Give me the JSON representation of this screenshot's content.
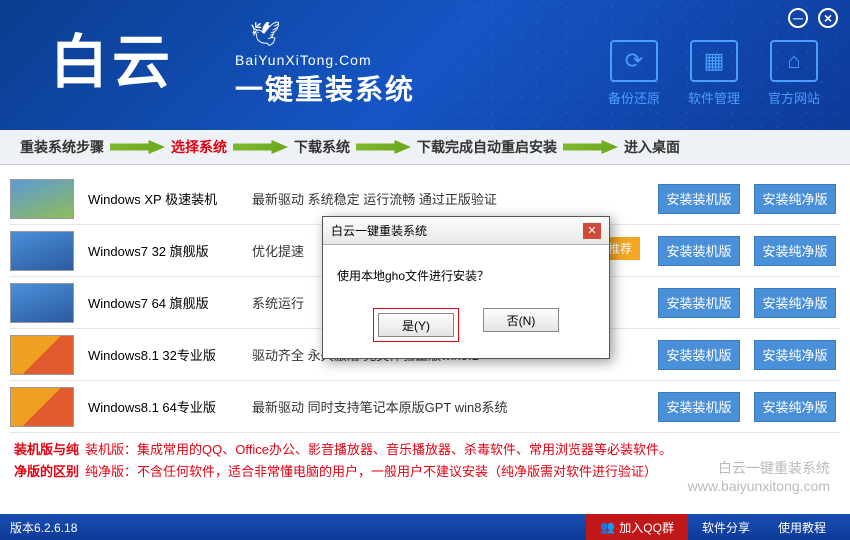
{
  "header": {
    "logo": "白云",
    "url": "BaiYunXiTong.Com",
    "slogan": "一键重装系统",
    "nav": [
      {
        "icon": "⟳",
        "label": "备份还原"
      },
      {
        "icon": "▦",
        "label": "软件管理"
      },
      {
        "icon": "⌂",
        "label": "官方网站"
      }
    ]
  },
  "steps": {
    "s1": "重装系统步骤",
    "s2": "选择系统",
    "s3": "下载系统",
    "s4": "下载完成自动重启安装",
    "s5": "进入桌面"
  },
  "systems": [
    {
      "name": "Windows XP 极速装机",
      "desc": "最新驱动 系统稳定 运行流畅 通过正版验证",
      "thumb": "xp"
    },
    {
      "name": "Windows7 32 旗舰版",
      "desc": "优化提速",
      "thumb": "w7",
      "recommend": true
    },
    {
      "name": "Windows7 64 旗舰版",
      "desc": "系统运行",
      "thumb": "w7"
    },
    {
      "name": "Windows8.1 32专业版",
      "desc": "驱动齐全 永久激活 完美体验正版win8.1",
      "thumb": "w8"
    },
    {
      "name": "Windows8.1 64专业版",
      "desc": "最新驱动 同时支持笔记本原版GPT win8系统",
      "thumb": "w8"
    }
  ],
  "buttons": {
    "install": "安装装机版",
    "clean": "安装纯净版"
  },
  "recommend_label": "推荐",
  "notes": {
    "l1_label": "装机版与纯",
    "l1_text": "装机版：集成常用的QQ、Office办公、影音播放器、音乐播放器、杀毒软件、常用浏览器等必装软件。",
    "l2_label": "净版的区别",
    "l2_text": "纯净版：不含任何软件，适合非常懂电脑的用户，一般用户不建议安装（纯净版需对软件进行验证）"
  },
  "watermark": {
    "l1": "白云一键重装系统",
    "l2": "www.baiyunxitong.com"
  },
  "bottom": {
    "version": "版本6.2.6.18",
    "qq": "加入QQ群",
    "share": "软件分享",
    "tutorial": "使用教程"
  },
  "dialog": {
    "title": "白云一键重装系统",
    "message": "使用本地gho文件进行安装？",
    "yes": "是(Y)",
    "no": "否(N)"
  }
}
